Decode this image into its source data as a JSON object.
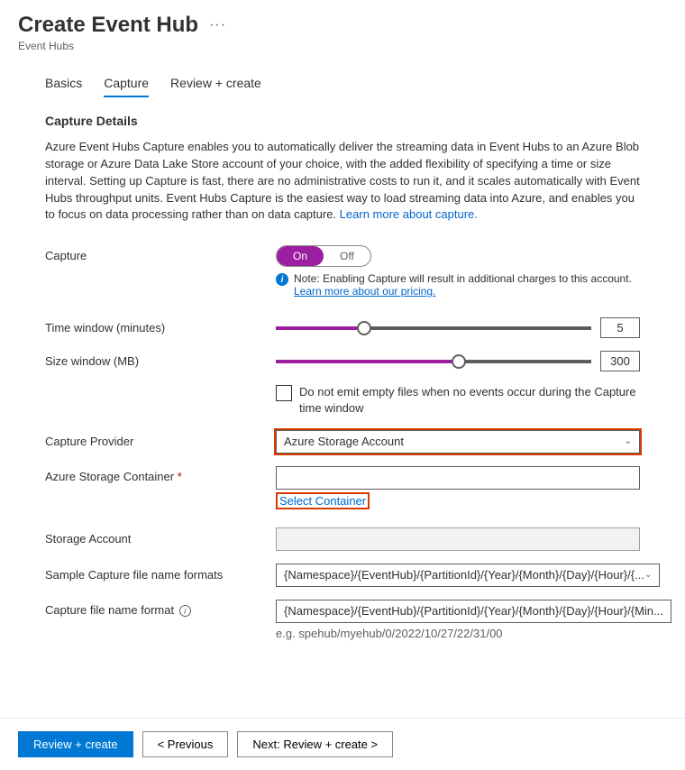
{
  "header": {
    "title": "Create Event Hub",
    "breadcrumb": "Event Hubs"
  },
  "tabs": [
    {
      "label": "Basics"
    },
    {
      "label": "Capture"
    },
    {
      "label": "Review + create"
    }
  ],
  "section": {
    "title": "Capture Details",
    "description_pre": "Azure Event Hubs Capture enables you to automatically deliver the streaming data in Event Hubs to an Azure Blob storage or Azure Data Lake Store account of your choice, with the added flexibility of specifying a time or size interval. Setting up Capture is fast, there are no administrative costs to run it, and it scales automatically with Event Hubs throughput units. Event Hubs Capture is the easiest way to load streaming data into Azure, and enables you to focus on data processing rather than on data capture. ",
    "learn_link": "Learn more about capture."
  },
  "capture": {
    "label": "Capture",
    "on": "On",
    "off": "Off",
    "note": "Note: Enabling Capture will result in additional charges to this account.",
    "pricing_link": "Learn more about our pricing."
  },
  "time_window": {
    "label": "Time window (minutes)",
    "value": "5",
    "pct": 28
  },
  "size_window": {
    "label": "Size window (MB)",
    "value": "300",
    "pct": 58
  },
  "empty_files": {
    "label": "Do not emit empty files when no events occur during the Capture time window"
  },
  "provider": {
    "label": "Capture Provider",
    "value": "Azure Storage Account"
  },
  "container": {
    "label": "Azure Storage Container",
    "select_link": "Select Container"
  },
  "storage_account": {
    "label": "Storage Account"
  },
  "sample_formats": {
    "label": "Sample Capture file name formats",
    "value": "{Namespace}/{EventHub}/{PartitionId}/{Year}/{Month}/{Day}/{Hour}/{..."
  },
  "file_format": {
    "label": "Capture file name format",
    "value": "{Namespace}/{EventHub}/{PartitionId}/{Year}/{Month}/{Day}/{Hour}/{Min...",
    "example": "e.g. spehub/myehub/0/2022/10/27/22/31/00"
  },
  "footer": {
    "review": "Review + create",
    "prev": "< Previous",
    "next": "Next: Review + create >"
  }
}
